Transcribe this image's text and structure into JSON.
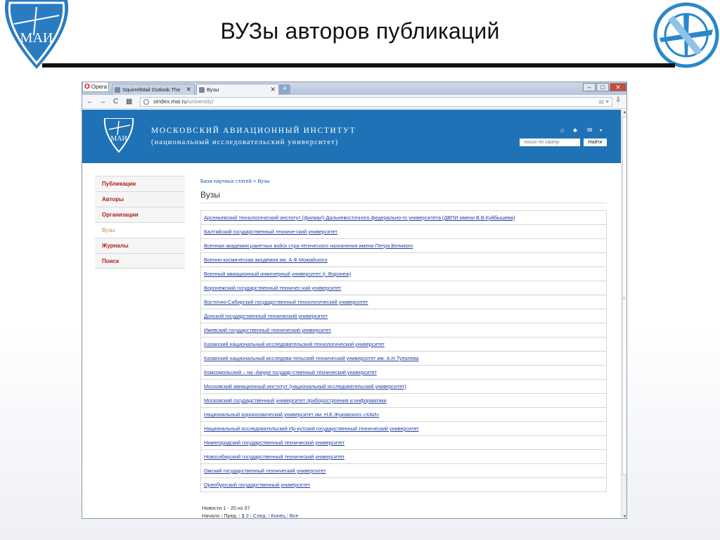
{
  "slide": {
    "title": "ВУЗы авторов публикаций",
    "logo_text": "МАИ"
  },
  "browser": {
    "opera_label": "Opera",
    "tabs": [
      {
        "label": "SquirrelMail Outlook The"
      },
      {
        "label": "Вузы"
      }
    ],
    "newtab_label": "+",
    "address_host": "sindex.mai.ru",
    "address_path": "/university/"
  },
  "site": {
    "logo_text": "МАИ",
    "name": "МОСКОВСКИЙ АВИАЦИОННЫЙ ИНСТИТУТ",
    "subtitle": "(национальный исследовательский университет)",
    "search_placeholder": "поиск по сайту",
    "search_button": "Найти"
  },
  "sidebar": {
    "items": [
      {
        "label": "Публикации"
      },
      {
        "label": "Авторы"
      },
      {
        "label": "Организации"
      },
      {
        "label": "Вузы",
        "active": true
      },
      {
        "label": "Журналы"
      },
      {
        "label": "Поиск"
      }
    ]
  },
  "main": {
    "breadcrumb": "База научных статей > Вузы",
    "heading": "Вузы",
    "universities": [
      "Арсеньевский технологический институт (филиал) Дальневосточного федерально-го университета (ДВПИ имени В.В.Куйбышева)",
      "Балтийский государственный техниче-ский университет",
      "Военная академия ракетных войск стра-тегического назначения имени Петра Великого",
      "Военно-космическая академия им. А.Ф.Можайского",
      "Военный авиационный инженерный университет (г. Воронеж)",
      "Воронежский государственный техничес-кий университет",
      "Восточно-Сибирский государственный технологический университет",
      "Донской государственный технический университет",
      "Ижевский государственный технический университет",
      "Казанский национальный исследовательский технологический университет",
      "Казанский национальный исследова-тельский технический университет им. А.Н.Туполева",
      "Комсомольский – на -Амуре государ-ственный технический университет",
      "Московский авиационный институт (национальный исследовательский университет)",
      "Московский государственный университет приборостроения и информатики",
      "Национальный аэрокосмический университет им. Н.Е.Жуковского «ХАИ»",
      "Национальный исследовательский Ир-кутский государственный технический университет",
      "Нижегородский государственный технический университет",
      "Новосибирский государственный технический университет",
      "Омский государственный технический университет",
      "Оренбургский государственный университет"
    ],
    "pager_info": "Новости 1 - 20 из 37",
    "pager": {
      "start": "Начало",
      "prev": "Пред.",
      "page1": "1",
      "page2": "2",
      "next": "След.",
      "end": "Конец",
      "all": "Все"
    }
  },
  "colors": {
    "header_blue": "#1f72b5",
    "link_blue": "#1f3fa0",
    "sidebar_red": "#b01a1a"
  }
}
